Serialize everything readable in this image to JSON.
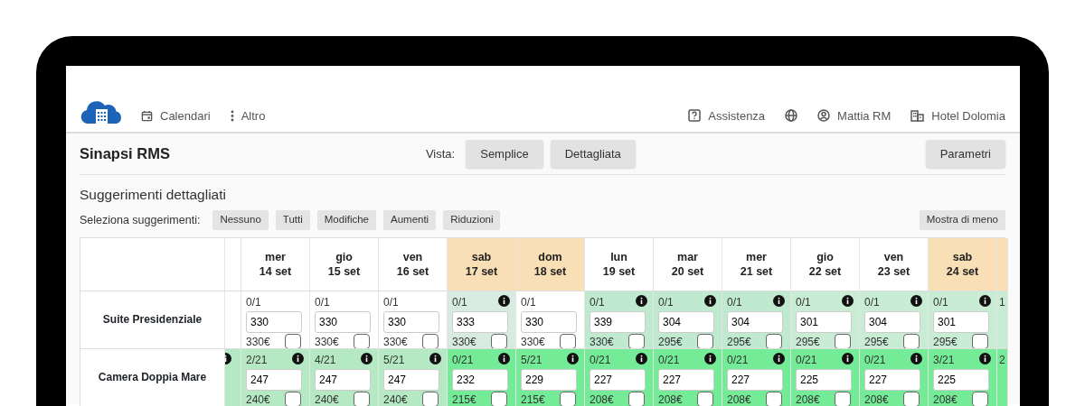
{
  "nav": {
    "items": [
      {
        "label": "Calendari",
        "kind": "calendar"
      },
      {
        "label": "Altro",
        "kind": "more"
      }
    ],
    "right": [
      {
        "label": "Assistenza",
        "kind": "help"
      },
      {
        "label": "Mattia RM",
        "kind": "user"
      },
      {
        "label": "Hotel Dolomia",
        "kind": "hotel"
      }
    ]
  },
  "header": {
    "title": "Sinapsi RMS",
    "view_label": "Vista:",
    "view_buttons": [
      "Semplice",
      "Dettagliata"
    ],
    "params_button": "Parametri"
  },
  "section": {
    "title": "Suggerimenti dettagliati",
    "select_label": "Seleziona suggerimenti:",
    "select_buttons": [
      "Nessuno",
      "Tutti",
      "Modifiche",
      "Aumenti",
      "Riduzioni"
    ],
    "toggle_button": "Mostra di meno"
  },
  "table": {
    "columns": [
      {
        "day": "mer",
        "date": "14 set",
        "weekend": false
      },
      {
        "day": "gio",
        "date": "15 set",
        "weekend": false
      },
      {
        "day": "ven",
        "date": "16 set",
        "weekend": false
      },
      {
        "day": "sab",
        "date": "17 set",
        "weekend": true
      },
      {
        "day": "dom",
        "date": "18 set",
        "weekend": true
      },
      {
        "day": "lun",
        "date": "19 set",
        "weekend": false
      },
      {
        "day": "mar",
        "date": "20 set",
        "weekend": false
      },
      {
        "day": "mer",
        "date": "21 set",
        "weekend": false
      },
      {
        "day": "gio",
        "date": "22 set",
        "weekend": false
      },
      {
        "day": "ven",
        "date": "23 set",
        "weekend": false
      },
      {
        "day": "sab",
        "date": "24 set",
        "weekend": true
      }
    ],
    "rows": [
      {
        "name": "Suite Presidenziale",
        "left_edge": {
          "color": "#ffffff",
          "info": false
        },
        "right_edge": {
          "color": "#c9ecd4",
          "text": "1"
        },
        "cells": [
          {
            "occupancy": "0/1",
            "value": "330",
            "price": "330€",
            "info": false,
            "checked": false,
            "color": "#ffffff"
          },
          {
            "occupancy": "0/1",
            "value": "330",
            "price": "330€",
            "info": false,
            "checked": false,
            "color": "#ffffff"
          },
          {
            "occupancy": "0/1",
            "value": "330",
            "price": "330€",
            "info": false,
            "checked": false,
            "color": "#ffffff"
          },
          {
            "occupancy": "0/1",
            "value": "333",
            "price": "330€",
            "info": true,
            "checked": false,
            "color": "#d8ebe0"
          },
          {
            "occupancy": "0/1",
            "value": "330",
            "price": "330€",
            "info": false,
            "checked": false,
            "color": "#ffffff"
          },
          {
            "occupancy": "0/1",
            "value": "339",
            "price": "330€",
            "info": true,
            "checked": false,
            "color": "#bfead0"
          },
          {
            "occupancy": "0/1",
            "value": "304",
            "price": "295€",
            "info": true,
            "checked": false,
            "color": "#bfead0"
          },
          {
            "occupancy": "0/1",
            "value": "304",
            "price": "295€",
            "info": true,
            "checked": false,
            "color": "#bfead0"
          },
          {
            "occupancy": "0/1",
            "value": "301",
            "price": "295€",
            "info": true,
            "checked": false,
            "color": "#c9ecd4"
          },
          {
            "occupancy": "0/1",
            "value": "304",
            "price": "295€",
            "info": true,
            "checked": false,
            "color": "#c9ecd4"
          },
          {
            "occupancy": "0/1",
            "value": "301",
            "price": "295€",
            "info": true,
            "checked": false,
            "color": "#c9ecd4"
          }
        ]
      },
      {
        "name": "Camera Doppia Mare",
        "left_edge": {
          "color": "#b5e9c4",
          "info": true
        },
        "right_edge": {
          "color": "#74ec97",
          "text": "2"
        },
        "cells": [
          {
            "occupancy": "2/21",
            "value": "247",
            "price": "240€",
            "info": true,
            "checked": false,
            "color": "#b5e9c4"
          },
          {
            "occupancy": "4/21",
            "value": "247",
            "price": "240€",
            "info": true,
            "checked": false,
            "color": "#b5e9c4"
          },
          {
            "occupancy": "5/21",
            "value": "247",
            "price": "240€",
            "info": true,
            "checked": false,
            "color": "#b5e9c4"
          },
          {
            "occupancy": "0/21",
            "value": "232",
            "price": "215€",
            "info": true,
            "checked": false,
            "color": "#74ec97"
          },
          {
            "occupancy": "5/21",
            "value": "229",
            "price": "215€",
            "info": true,
            "checked": false,
            "color": "#74ec97"
          },
          {
            "occupancy": "0/21",
            "value": "227",
            "price": "208€",
            "info": true,
            "checked": false,
            "color": "#74ec97"
          },
          {
            "occupancy": "0/21",
            "value": "227",
            "price": "208€",
            "info": true,
            "checked": false,
            "color": "#74ec97"
          },
          {
            "occupancy": "0/21",
            "value": "227",
            "price": "208€",
            "info": true,
            "checked": false,
            "color": "#74ec97"
          },
          {
            "occupancy": "0/21",
            "value": "225",
            "price": "208€",
            "info": true,
            "checked": false,
            "color": "#74ec97"
          },
          {
            "occupancy": "0/21",
            "value": "227",
            "price": "208€",
            "info": true,
            "checked": false,
            "color": "#74ec97"
          },
          {
            "occupancy": "3/21",
            "value": "225",
            "price": "208€",
            "info": true,
            "checked": false,
            "color": "#74ec97"
          }
        ]
      }
    ]
  }
}
